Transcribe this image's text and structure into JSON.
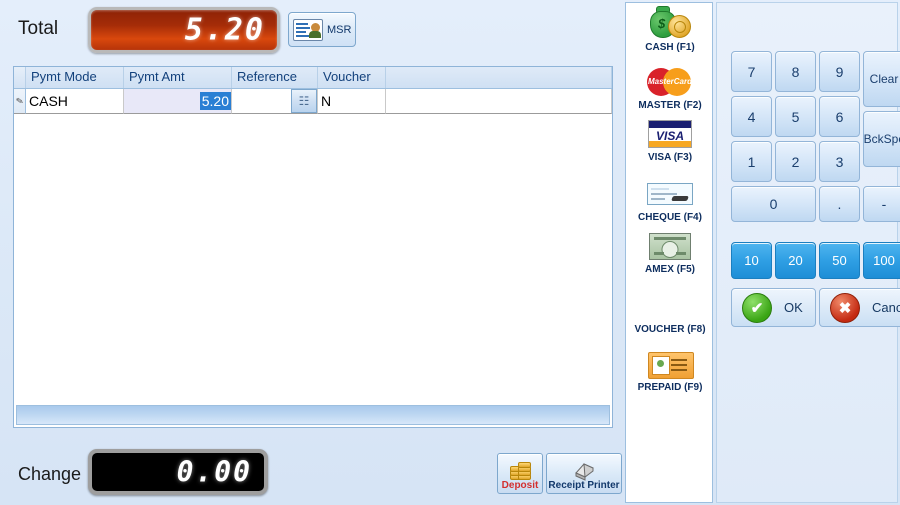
{
  "header": {
    "total_label": "Total",
    "total_value": "5.20",
    "msr_label": "MSR",
    "msr_icon": "id-card-icon"
  },
  "grid": {
    "columns": [
      "Pymt Mode",
      "Pymt Amt",
      "Reference",
      "Voucher"
    ],
    "rows": [
      {
        "indicator": "✎",
        "pymt_mode": "CASH",
        "pymt_amt": "5.20",
        "reference": "",
        "reference_button_icon": "lookup-icon",
        "voucher": "N"
      }
    ]
  },
  "footer": {
    "change_label": "Change",
    "change_value": "0.00",
    "deposit_label": "Deposit",
    "deposit_icon": "coins-icon",
    "receipt_label": "Receipt Printer",
    "receipt_icon": "printer-icon"
  },
  "payment_methods": [
    {
      "label": "CASH (F1)",
      "icon": "cash-bag-icon"
    },
    {
      "label": "MASTER (F2)",
      "icon": "mastercard-icon",
      "brand_text": "MasterCard"
    },
    {
      "label": "VISA (F3)",
      "icon": "visa-icon",
      "brand_text": "VISA"
    },
    {
      "label": "CHEQUE (F4)",
      "icon": "cheque-icon"
    },
    {
      "label": "AMEX (F5)",
      "icon": "amex-card-icon"
    },
    {
      "label": "VOUCHER (F8)",
      "icon": "none"
    },
    {
      "label": "PREPAID (F9)",
      "icon": "prepaid-card-icon"
    }
  ],
  "keypad": {
    "digits": [
      "7",
      "8",
      "9",
      "4",
      "5",
      "6",
      "1",
      "2",
      "3"
    ],
    "zero": "0",
    "dot": ".",
    "dash": "-",
    "clear": "Clear",
    "backspace": "BckSpc",
    "quick_amounts": [
      "10",
      "20",
      "50",
      "100"
    ],
    "ok": "OK",
    "cancel": "Cancel",
    "ok_icon": "check-circle-icon",
    "cancel_icon": "x-circle-icon"
  },
  "colors": {
    "page_bg": "#dde9f8",
    "total_display": "#a52c08",
    "change_display": "#000000",
    "accent_blue": "#2f9fe4",
    "ok_green": "#3aa514",
    "cancel_red": "#c42a12",
    "selection_blue": "#2a7fd4"
  }
}
